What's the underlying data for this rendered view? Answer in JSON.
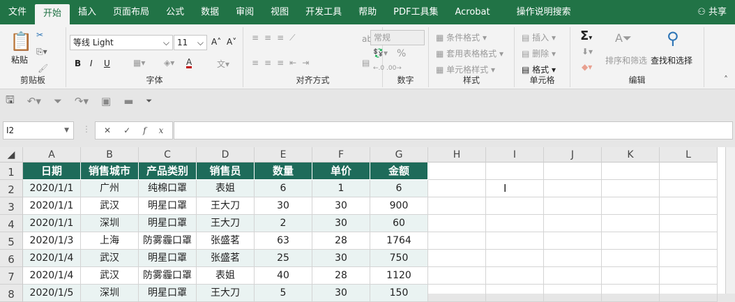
{
  "tabs": [
    "文件",
    "开始",
    "插入",
    "页面布局",
    "公式",
    "数据",
    "审阅",
    "视图",
    "开发工具",
    "帮助",
    "PDF工具集",
    "Acrobat",
    "操作说明搜索"
  ],
  "share": "共享",
  "ribbon": {
    "clipboard": {
      "paste": "粘贴",
      "label": "剪贴板"
    },
    "font": {
      "name": "等线 Light",
      "size": "11",
      "label": "字体",
      "bold": "B",
      "italic": "I",
      "underline": "U",
      "color": "#c00000"
    },
    "align": {
      "label": "对齐方式"
    },
    "number": {
      "format": "常规",
      "percent": "%",
      "label": "数字"
    },
    "styles": {
      "cond": "条件格式",
      "table": "套用表格格式",
      "cell": "单元格样式",
      "label": "样式"
    },
    "cells": {
      "insert": "插入",
      "delete": "删除",
      "format": "格式",
      "label": "单元格"
    },
    "editing": {
      "sum": "Σ",
      "sort": "排序和筛选",
      "find": "查找和选择",
      "label": "编辑"
    }
  },
  "formula": {
    "namebox": "I2",
    "value": ""
  },
  "columns": [
    "A",
    "B",
    "C",
    "D",
    "E",
    "F",
    "G",
    "H",
    "I",
    "J",
    "K",
    "L"
  ],
  "rows": [
    "1",
    "2",
    "3",
    "4",
    "5",
    "6",
    "7",
    "8"
  ],
  "table": {
    "headers": [
      "日期",
      "销售城市",
      "产品类别",
      "销售员",
      "数量",
      "单价",
      "金额"
    ],
    "data": [
      [
        "2020/1/1",
        "广州",
        "纯棉口罩",
        "表姐",
        "6",
        "1",
        "6"
      ],
      [
        "2020/1/1",
        "武汉",
        "明星口罩",
        "王大刀",
        "30",
        "30",
        "900"
      ],
      [
        "2020/1/1",
        "深圳",
        "明星口罩",
        "王大刀",
        "2",
        "30",
        "60"
      ],
      [
        "2020/1/3",
        "上海",
        "防雾霾口罩",
        "张盛茗",
        "63",
        "28",
        "1764"
      ],
      [
        "2020/1/4",
        "武汉",
        "明星口罩",
        "张盛茗",
        "25",
        "30",
        "750"
      ],
      [
        "2020/1/4",
        "武汉",
        "防雾霾口罩",
        "表姐",
        "40",
        "28",
        "1120"
      ],
      [
        "2020/1/5",
        "深圳",
        "明星口罩",
        "王大刀",
        "5",
        "30",
        "150"
      ]
    ]
  }
}
